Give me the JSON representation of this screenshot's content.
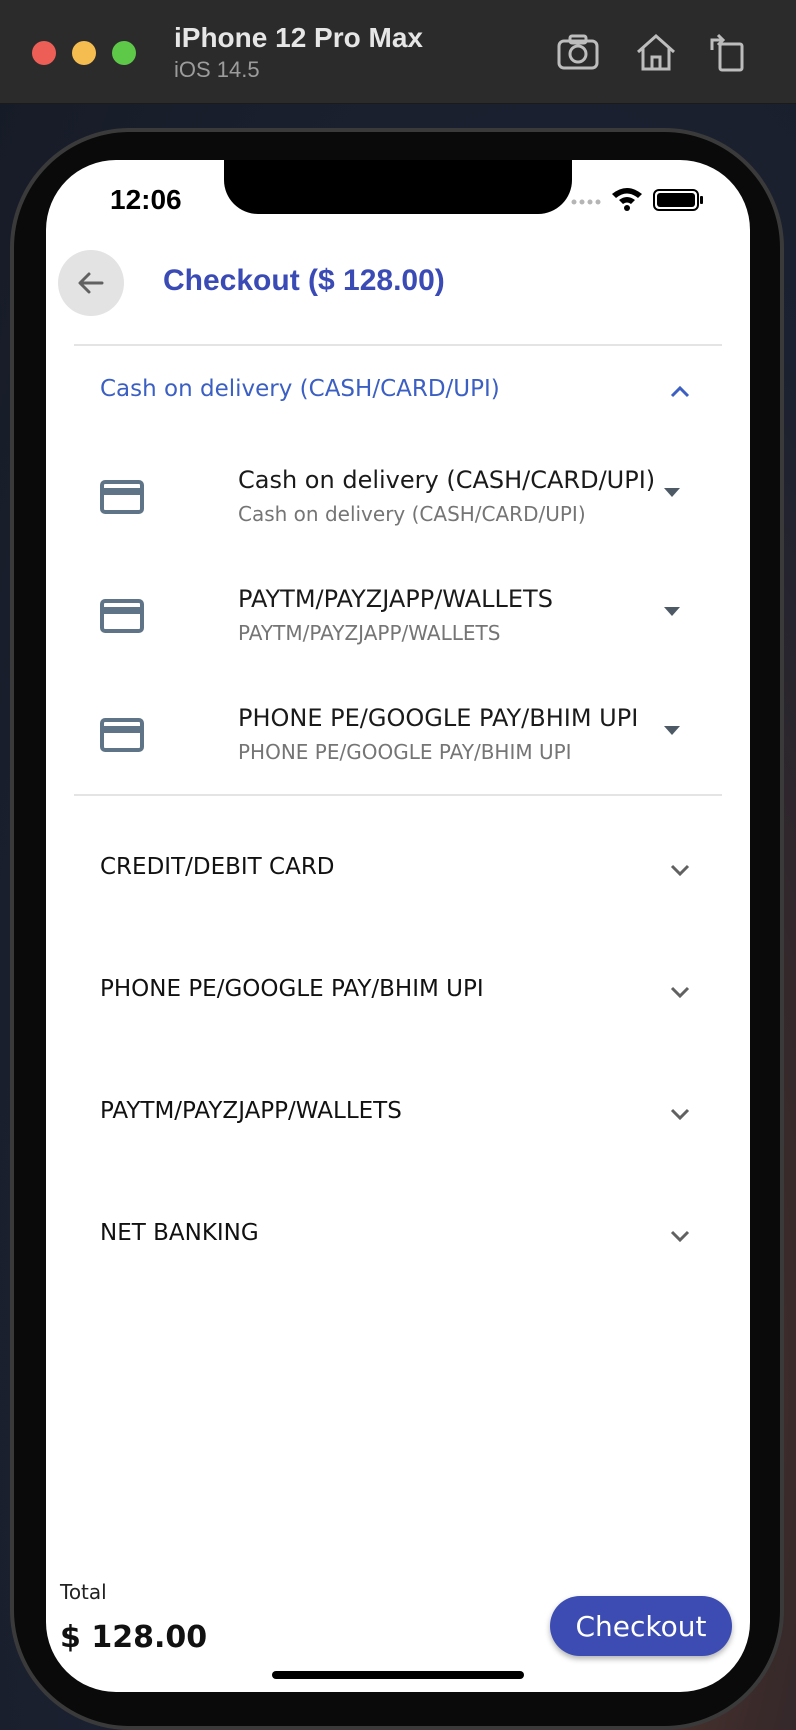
{
  "simulator": {
    "device": "iPhone 12 Pro Max",
    "os": "iOS 14.5",
    "icons": [
      "screenshot-icon",
      "home-icon",
      "rotate-icon"
    ]
  },
  "status_bar": {
    "time": "12:06"
  },
  "header": {
    "title": "Checkout ($ 128.00)",
    "accent": "#3b4bb5"
  },
  "payment_sections": {
    "expanded": {
      "label": "Cash on delivery (CASH/CARD/UPI)",
      "options": [
        {
          "title": "Cash on delivery (CASH/CARD/UPI)",
          "subtitle": "Cash on delivery (CASH/CARD/UPI)"
        },
        {
          "title": "PAYTM/PAYZJAPP/WALLETS",
          "subtitle": "PAYTM/PAYZJAPP/WALLETS"
        },
        {
          "title": "PHONE PE/GOOGLE PAY/BHIM UPI",
          "subtitle": "PHONE PE/GOOGLE PAY/BHIM UPI"
        }
      ]
    },
    "collapsed": [
      {
        "label": "CREDIT/DEBIT CARD"
      },
      {
        "label": "PHONE PE/GOOGLE PAY/BHIM UPI"
      },
      {
        "label": "PAYTM/PAYZJAPP/WALLETS"
      },
      {
        "label": "NET BANKING"
      }
    ]
  },
  "footer": {
    "total_label": "Total",
    "total_value": "$ 128.00",
    "checkout_label": "Checkout",
    "button_color": "#3c4cb3"
  }
}
